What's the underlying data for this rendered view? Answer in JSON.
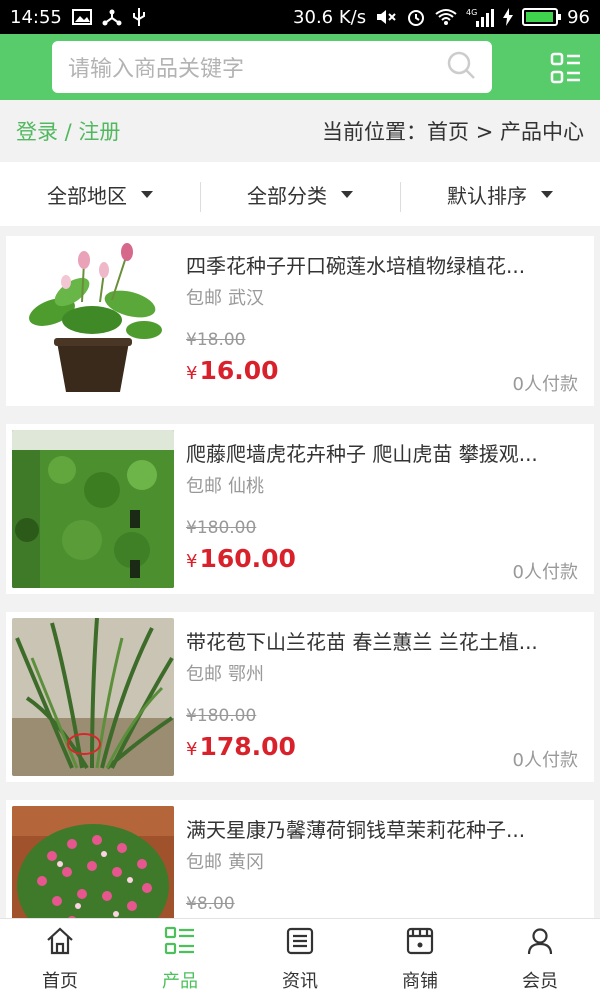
{
  "status": {
    "time": "14:55",
    "speed": "30.6 K/s",
    "battery": "96",
    "battery_fill": 0.96,
    "network": "4G"
  },
  "search": {
    "placeholder": "请输入商品关键字"
  },
  "location": {
    "login_register": "登录 / 注册",
    "breadcrumb": "当前位置：首页 > 产品中心"
  },
  "filters": [
    {
      "label": "全部地区"
    },
    {
      "label": "全部分类"
    },
    {
      "label": "默认排序"
    }
  ],
  "products": [
    {
      "title": "四季花种子开口碗莲水培植物绿植花...",
      "shipping": "包邮",
      "city": "武汉",
      "old_price": "¥18.00",
      "currency": "¥",
      "price": "16.00",
      "paid": "0人付款",
      "thumb_icon": "lotus-plant-photo"
    },
    {
      "title": "爬藤爬墙虎花卉种子 爬山虎苗 攀援观...",
      "shipping": "包邮",
      "city": "仙桃",
      "old_price": "¥180.00",
      "currency": "¥",
      "price": "160.00",
      "paid": "0人付款",
      "thumb_icon": "ivy-wall-photo"
    },
    {
      "title": "带花苞下山兰花苗 春兰蕙兰 兰花土植...",
      "shipping": "包邮",
      "city": "鄂州",
      "old_price": "¥180.00",
      "currency": "¥",
      "price": "178.00",
      "paid": "0人付款",
      "thumb_icon": "orchid-photo"
    },
    {
      "title": "满天星康乃馨薄荷铜钱草茉莉花种子...",
      "shipping": "包邮",
      "city": "黄冈",
      "old_price": "¥8.00",
      "currency": "¥",
      "price": "",
      "paid": "",
      "thumb_icon": "pink-flowers-photo"
    }
  ],
  "bottom_nav": [
    {
      "label": "首页",
      "icon": "home-icon"
    },
    {
      "label": "产品",
      "icon": "products-icon",
      "active": true
    },
    {
      "label": "资讯",
      "icon": "news-icon"
    },
    {
      "label": "商铺",
      "icon": "shop-icon"
    },
    {
      "label": "会员",
      "icon": "member-icon"
    }
  ],
  "colors": {
    "accent": "#58cc6a",
    "price": "#d9212b",
    "active_nav": "#4cc05b"
  }
}
